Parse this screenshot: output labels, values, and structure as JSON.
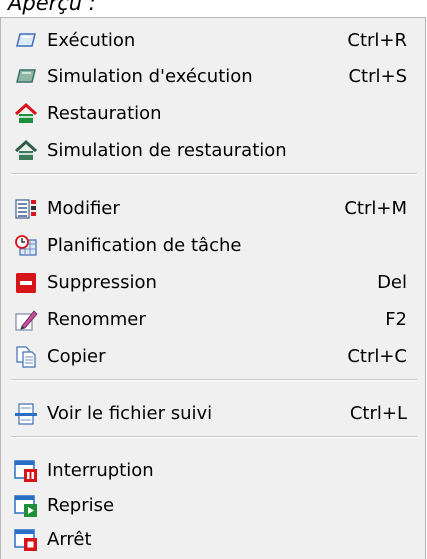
{
  "caption": "Aperçu :",
  "menu": {
    "items": [
      {
        "label": "Exécution",
        "shortcut": "Ctrl+R",
        "icon": "execute-icon"
      },
      {
        "label": "Simulation d'exécution",
        "shortcut": "Ctrl+S",
        "icon": "simulate-execute-icon"
      },
      {
        "label": "Restauration",
        "shortcut": "",
        "icon": "restore-icon"
      },
      {
        "label": "Simulation de restauration",
        "shortcut": "",
        "icon": "simulate-restore-icon"
      },
      {
        "label": "Modifier",
        "shortcut": "Ctrl+M",
        "icon": "edit-list-icon"
      },
      {
        "label": "Planification de tâche",
        "shortcut": "",
        "icon": "schedule-icon"
      },
      {
        "label": "Suppression",
        "shortcut": "Del",
        "icon": "delete-icon"
      },
      {
        "label": "Renommer",
        "shortcut": "F2",
        "icon": "rename-icon"
      },
      {
        "label": "Copier",
        "shortcut": "Ctrl+C",
        "icon": "copy-icon"
      },
      {
        "label": "Voir le fichier suivi",
        "shortcut": "Ctrl+L",
        "icon": "log-file-icon"
      },
      {
        "label": "Interruption",
        "shortcut": "",
        "icon": "pause-icon"
      },
      {
        "label": "Reprise",
        "shortcut": "",
        "icon": "resume-icon"
      },
      {
        "label": "Arrêt",
        "shortcut": "",
        "icon": "stop-icon"
      }
    ]
  },
  "colors": {
    "menu_bg": "#f0f0f0",
    "delete_red": "#d7141a",
    "window_blue": "#2a6fc6",
    "restore_green": "#1f8f3a"
  }
}
